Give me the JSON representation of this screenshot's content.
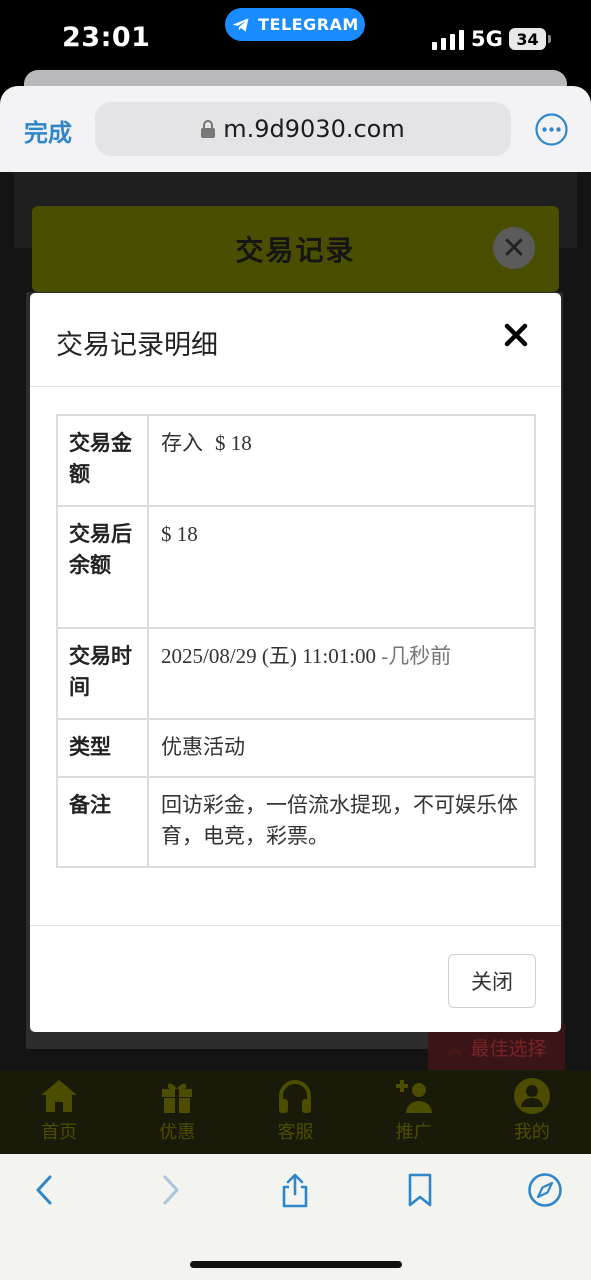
{
  "status_bar": {
    "time": "23:01",
    "pill_label": "TELEGRAM",
    "network": "5G",
    "battery": "34",
    "pill_color": "#1a8cff"
  },
  "browser": {
    "done_label": "完成",
    "url": "m.9d9030.com",
    "accent_color": "#2f86c9"
  },
  "page": {
    "header_title": "交易记录",
    "best_choice": "最佳选择",
    "nav": [
      {
        "label": "首页",
        "icon": "home-icon"
      },
      {
        "label": "优惠",
        "icon": "gift-icon"
      },
      {
        "label": "客服",
        "icon": "headphones-icon"
      },
      {
        "label": "推广",
        "icon": "add-user-icon"
      },
      {
        "label": "我的",
        "icon": "user-icon"
      }
    ]
  },
  "modal": {
    "title": "交易记录明细",
    "rows": [
      {
        "label": "交易金额",
        "type_word": "存入",
        "value": "$ 18"
      },
      {
        "label": "交易后余额",
        "value": "$ 18"
      },
      {
        "label": "交易时间",
        "value": "2025/08/29 (五) 11:01:00",
        "ago": "-几秒前"
      },
      {
        "label": "类型",
        "value": "优惠活动"
      },
      {
        "label": "备注",
        "value": "回访彩金，一倍流水提现，不可娱乐体育，电竞，彩票。"
      }
    ],
    "close_label": "关闭",
    "deposit_color": "#3c8a3f"
  }
}
